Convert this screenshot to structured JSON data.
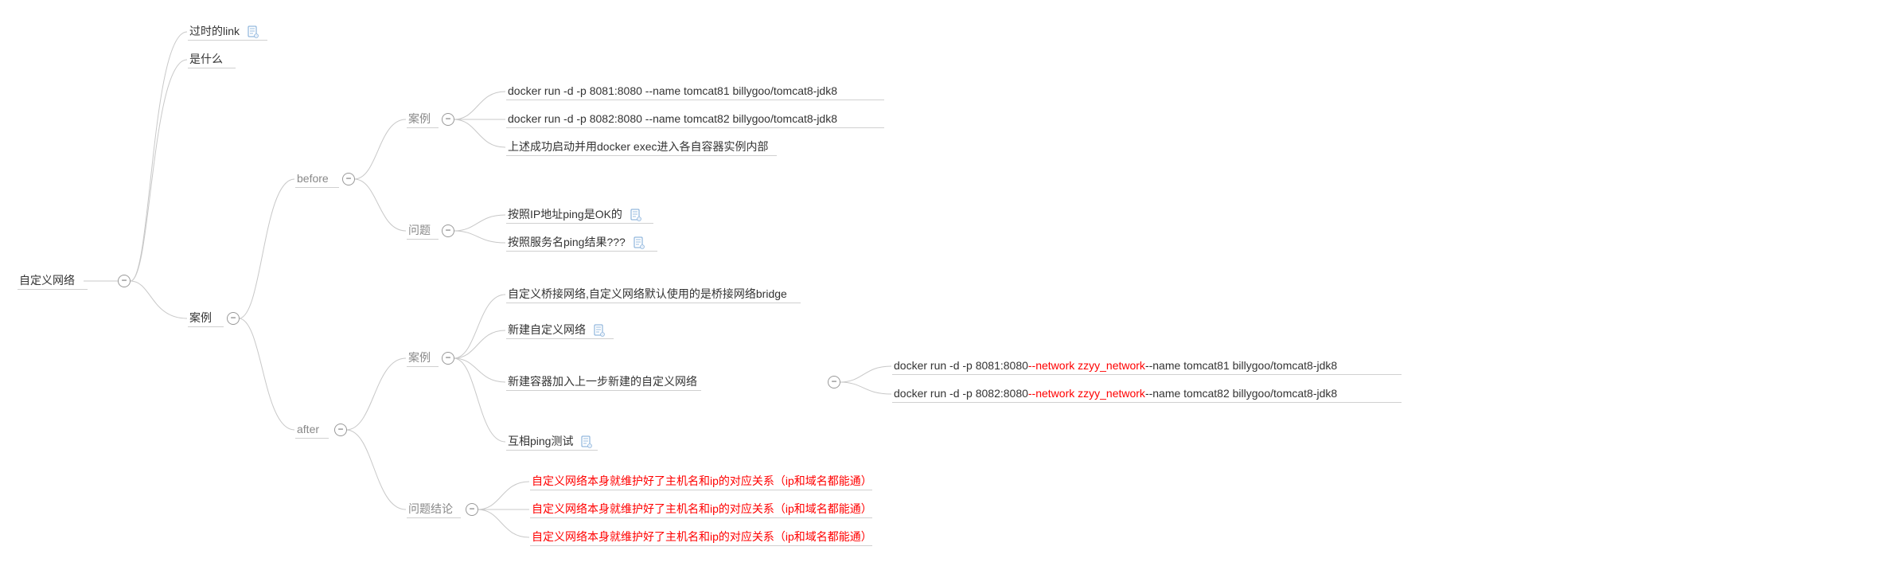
{
  "root": {
    "label": "自定义网络"
  },
  "l1": {
    "outdated_link": "过时的link",
    "what_is": "是什么",
    "case": "案例"
  },
  "before": {
    "label": "before",
    "case": "案例",
    "case_items": {
      "run1": "docker run -d -p 8081:8080   --name tomcat81 billygoo/tomcat8-jdk8",
      "run2": "docker run -d -p 8082:8080   --name tomcat82 billygoo/tomcat8-jdk8",
      "exec": "上述成功启动并用docker exec进入各自容器实例内部"
    },
    "problem": "问题",
    "problem_items": {
      "ping_ip": "按照IP地址ping是OK的",
      "ping_name": "按照服务名ping结果???"
    }
  },
  "after": {
    "label": "after",
    "case": "案例",
    "case_items": {
      "bridge_desc": "自定义桥接网络,自定义网络默认使用的是桥接网络bridge",
      "create_net": "新建自定义网络",
      "join_net": "新建容器加入上一步新建的自定义网络",
      "ping_test": "互相ping测试"
    },
    "join_cmds": {
      "run1_a": "docker run -d -p 8081:8080 ",
      "run1_b": "--network zzyy_network",
      "run1_c": "  --name tomcat81 billygoo/tomcat8-jdk8",
      "run2_a": "docker run -d -p 8082:8080 ",
      "run2_b": "--network zzyy_network",
      "run2_c": "  --name tomcat82 billygoo/tomcat8-jdk8"
    },
    "conclusion": "问题结论",
    "conclusion_items": {
      "c1": "自定义网络本身就维护好了主机名和ip的对应关系（ip和域名都能通）",
      "c2": "自定义网络本身就维护好了主机名和ip的对应关系（ip和域名都能通）",
      "c3": "自定义网络本身就维护好了主机名和ip的对应关系（ip和域名都能通）"
    }
  }
}
